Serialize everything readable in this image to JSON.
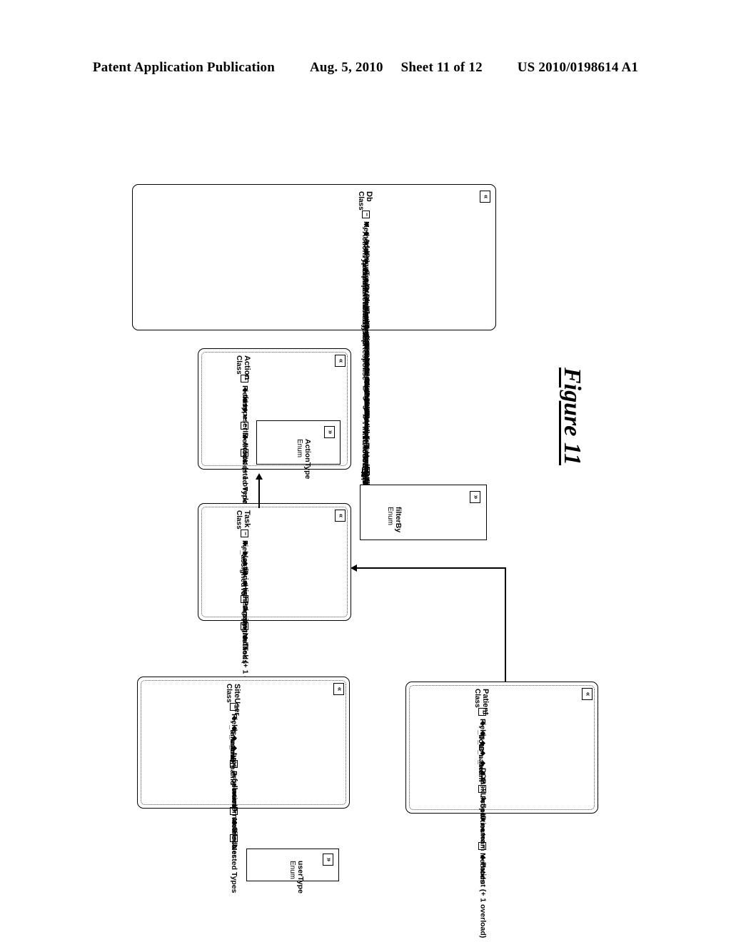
{
  "header": {
    "publication": "Patent Application Publication",
    "date": "Aug. 5, 2010",
    "sheet": "Sheet 11 of 12",
    "patent_number": "US 2010/0198614 A1"
  },
  "figure": {
    "caption": "Figure 11"
  },
  "glyphs": {
    "collapse": "«",
    "expand": "»",
    "group_toggle": "−"
  },
  "classes": [
    {
      "id": "db",
      "name": "Db",
      "kind": "Class",
      "groups": [
        {
          "label": "Methods",
          "members": [
            "ActionTypeToInt",
            "AddPt",
            "assignTask",
            "CompareActionsByDate",
            "CompareTasksByTopResponse",
            "createAssignment",
            "CreateTask",
            "Db",
            "deleteAssignment(+ 1 overload)",
            "getActiveTasksForPatient",
            "GetCaretakers",
            "getCompletedTasksForPatient",
            "GetPt",
            "GetPtList (+ 1 overload)",
            "GetPtListByFloor",
            "GetPtListByTeam",
            "GetPtListByUser(+ 1 overload)",
            "getTask",
            "getTeams",
            "getUser (+ 1 overload)",
            "getUsers",
            "IntToActionType",
            "IntToUserType",
            "RemovePt",
            "UpdateTask",
            "UserTypeToInt"
          ]
        },
        {
          "label": "Nested Types",
          "members": []
        }
      ],
      "nested": {
        "name": "filterBy",
        "kind": "Enum"
      }
    },
    {
      "id": "action",
      "name": "Action",
      "kind": "Class",
      "groups": [
        {
          "label": "Fields",
          "members": [
            "time",
            "type",
            "userID"
          ]
        },
        {
          "label": "Methods",
          "members": [
            "Action (+ 1 overload)"
          ]
        },
        {
          "label": "Nested Types",
          "members": []
        }
      ],
      "nested": {
        "name": "ActionType",
        "kind": "Enum"
      }
    },
    {
      "id": "task",
      "name": "Task",
      "kind": "Class",
      "groups": [
        {
          "label": "Fields",
          "members": [
            "_assignedTo",
            "actions",
            "ID",
            "isHighPriority",
            "message"
          ]
        },
        {
          "label": "Properties",
          "members": [
            "assignedTo"
          ]
        },
        {
          "label": "Methods",
          "members": [
            "Task (+ 1 overload)"
          ]
        }
      ],
      "nested": null
    },
    {
      "id": "siteuser",
      "name": "SiteUser",
      "kind": "Class",
      "groups": [
        {
          "label": "Fields",
          "members": [
            "_fullname",
            "_userID",
            "_username",
            "type"
          ]
        },
        {
          "label": "Properties",
          "members": [
            "fullname",
            "userID",
            "username"
          ]
        },
        {
          "label": "Methods",
          "members": [
            "SiteUser"
          ]
        },
        {
          "label": "Nested Types",
          "members": []
        }
      ],
      "nested": {
        "name": "userType",
        "kind": "Enum"
      }
    },
    {
      "id": "patient",
      "name": "Patient",
      "kind": "Class",
      "groups": [
        {
          "label": "Fields",
          "members": [
            "_floor",
            "_ID",
            "_name",
            "_team",
            "DOB",
            "taskList"
          ]
        },
        {
          "label": "Properties",
          "members": [
            "floor",
            "ID",
            "name",
            "team"
          ]
        },
        {
          "label": "Methods",
          "members": [
            "Patient (+ 1 overload)"
          ]
        }
      ],
      "nested": null
    }
  ]
}
